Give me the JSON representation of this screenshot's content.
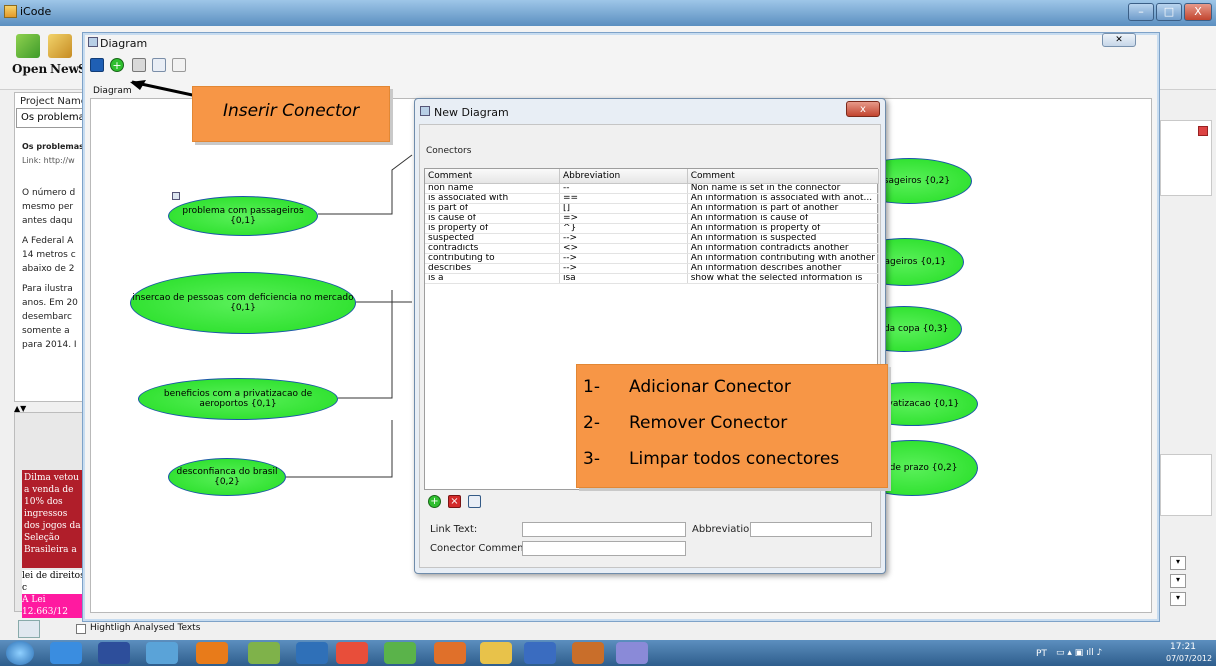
{
  "window": {
    "title": "iCode",
    "minimize": "–",
    "maximize": "□",
    "close": "X"
  },
  "toolbar": {
    "open": "Open",
    "new": "New",
    "s": "S"
  },
  "left_panel": {
    "project_label": "Project Name: C:",
    "project_value": "Os problemas qu",
    "preview_title": "Os problemas",
    "preview_link": "Link: http://w",
    "preview_lines": [
      "O número d",
      "mesmo per",
      "antes daqu",
      "A Federal A",
      "14 metros c",
      "abaixo de 2",
      "Para ilustra",
      "anos. Em 20",
      "desembarc",
      "somente a",
      "para 2014. I"
    ]
  },
  "left_lower": {
    "red_card": "Dilma vetou a venda de 10% dos ingressos dos jogos da Seleção Brasileira a",
    "pink_card_a": "lei de direitos c",
    "pink_card_b": "A Lei 12.663/12"
  },
  "diagram_window": {
    "title": "Diagram",
    "canvas_label": "Diagram"
  },
  "nodes": [
    {
      "label": "problema com passageiros {0,1}"
    },
    {
      "label": "insercao de pessoas com deficiencia no mercado {0,1}"
    },
    {
      "label": "beneficios com a privatizacao de aeroportos {0,1}"
    },
    {
      "label": "desconfianca do brasil {0,2}"
    },
    {
      "label": "passageiros {0,2}"
    },
    {
      "label": "passageiros {0,1}"
    },
    {
      "label": "acao da copa {0,3}"
    },
    {
      "label": "la privatizacao {0,1}"
    },
    {
      "label": "ento de prazo {0,2}"
    }
  ],
  "callouts": {
    "insert": "Inserir Conector",
    "steps": [
      {
        "num": "1-",
        "text": "Adicionar Conector"
      },
      {
        "num": "2-",
        "text": "Remover Conector"
      },
      {
        "num": "3-",
        "text": "Limpar todos conectores"
      }
    ]
  },
  "dialog": {
    "title": "New Diagram",
    "close": "x",
    "group_label": "Conectors",
    "columns": [
      "Comment",
      "Abbreviation",
      "Comment"
    ],
    "rows": [
      [
        "non name",
        "--",
        "Non name is set in the connector"
      ],
      [
        "is associated with",
        "==",
        "An information is associated with anot..."
      ],
      [
        "is part of",
        "[]",
        "An information is part of another"
      ],
      [
        "is cause of",
        "=>",
        "An information is cause of"
      ],
      [
        "is property of",
        "^}",
        "An information is property of"
      ],
      [
        "suspected",
        "-->",
        "An information is suspected"
      ],
      [
        "contradicts",
        "<>",
        "An information contradicts another"
      ],
      [
        "contributing to",
        "-->",
        "An information contributing with another"
      ],
      [
        "describes",
        "-->",
        "An information describes another"
      ],
      [
        "is a",
        "isa",
        "show what the selected information is"
      ]
    ],
    "link_text_label": "Link Text:",
    "abbreviation_label": "Abbreviation:",
    "conector_comment_label": "Conector Comment:"
  },
  "footer": {
    "highlight_label": "Hightligh Analysed Texts"
  },
  "taskbar": {
    "lang": "PT",
    "time": "17:21",
    "date": "07/07/2012"
  }
}
